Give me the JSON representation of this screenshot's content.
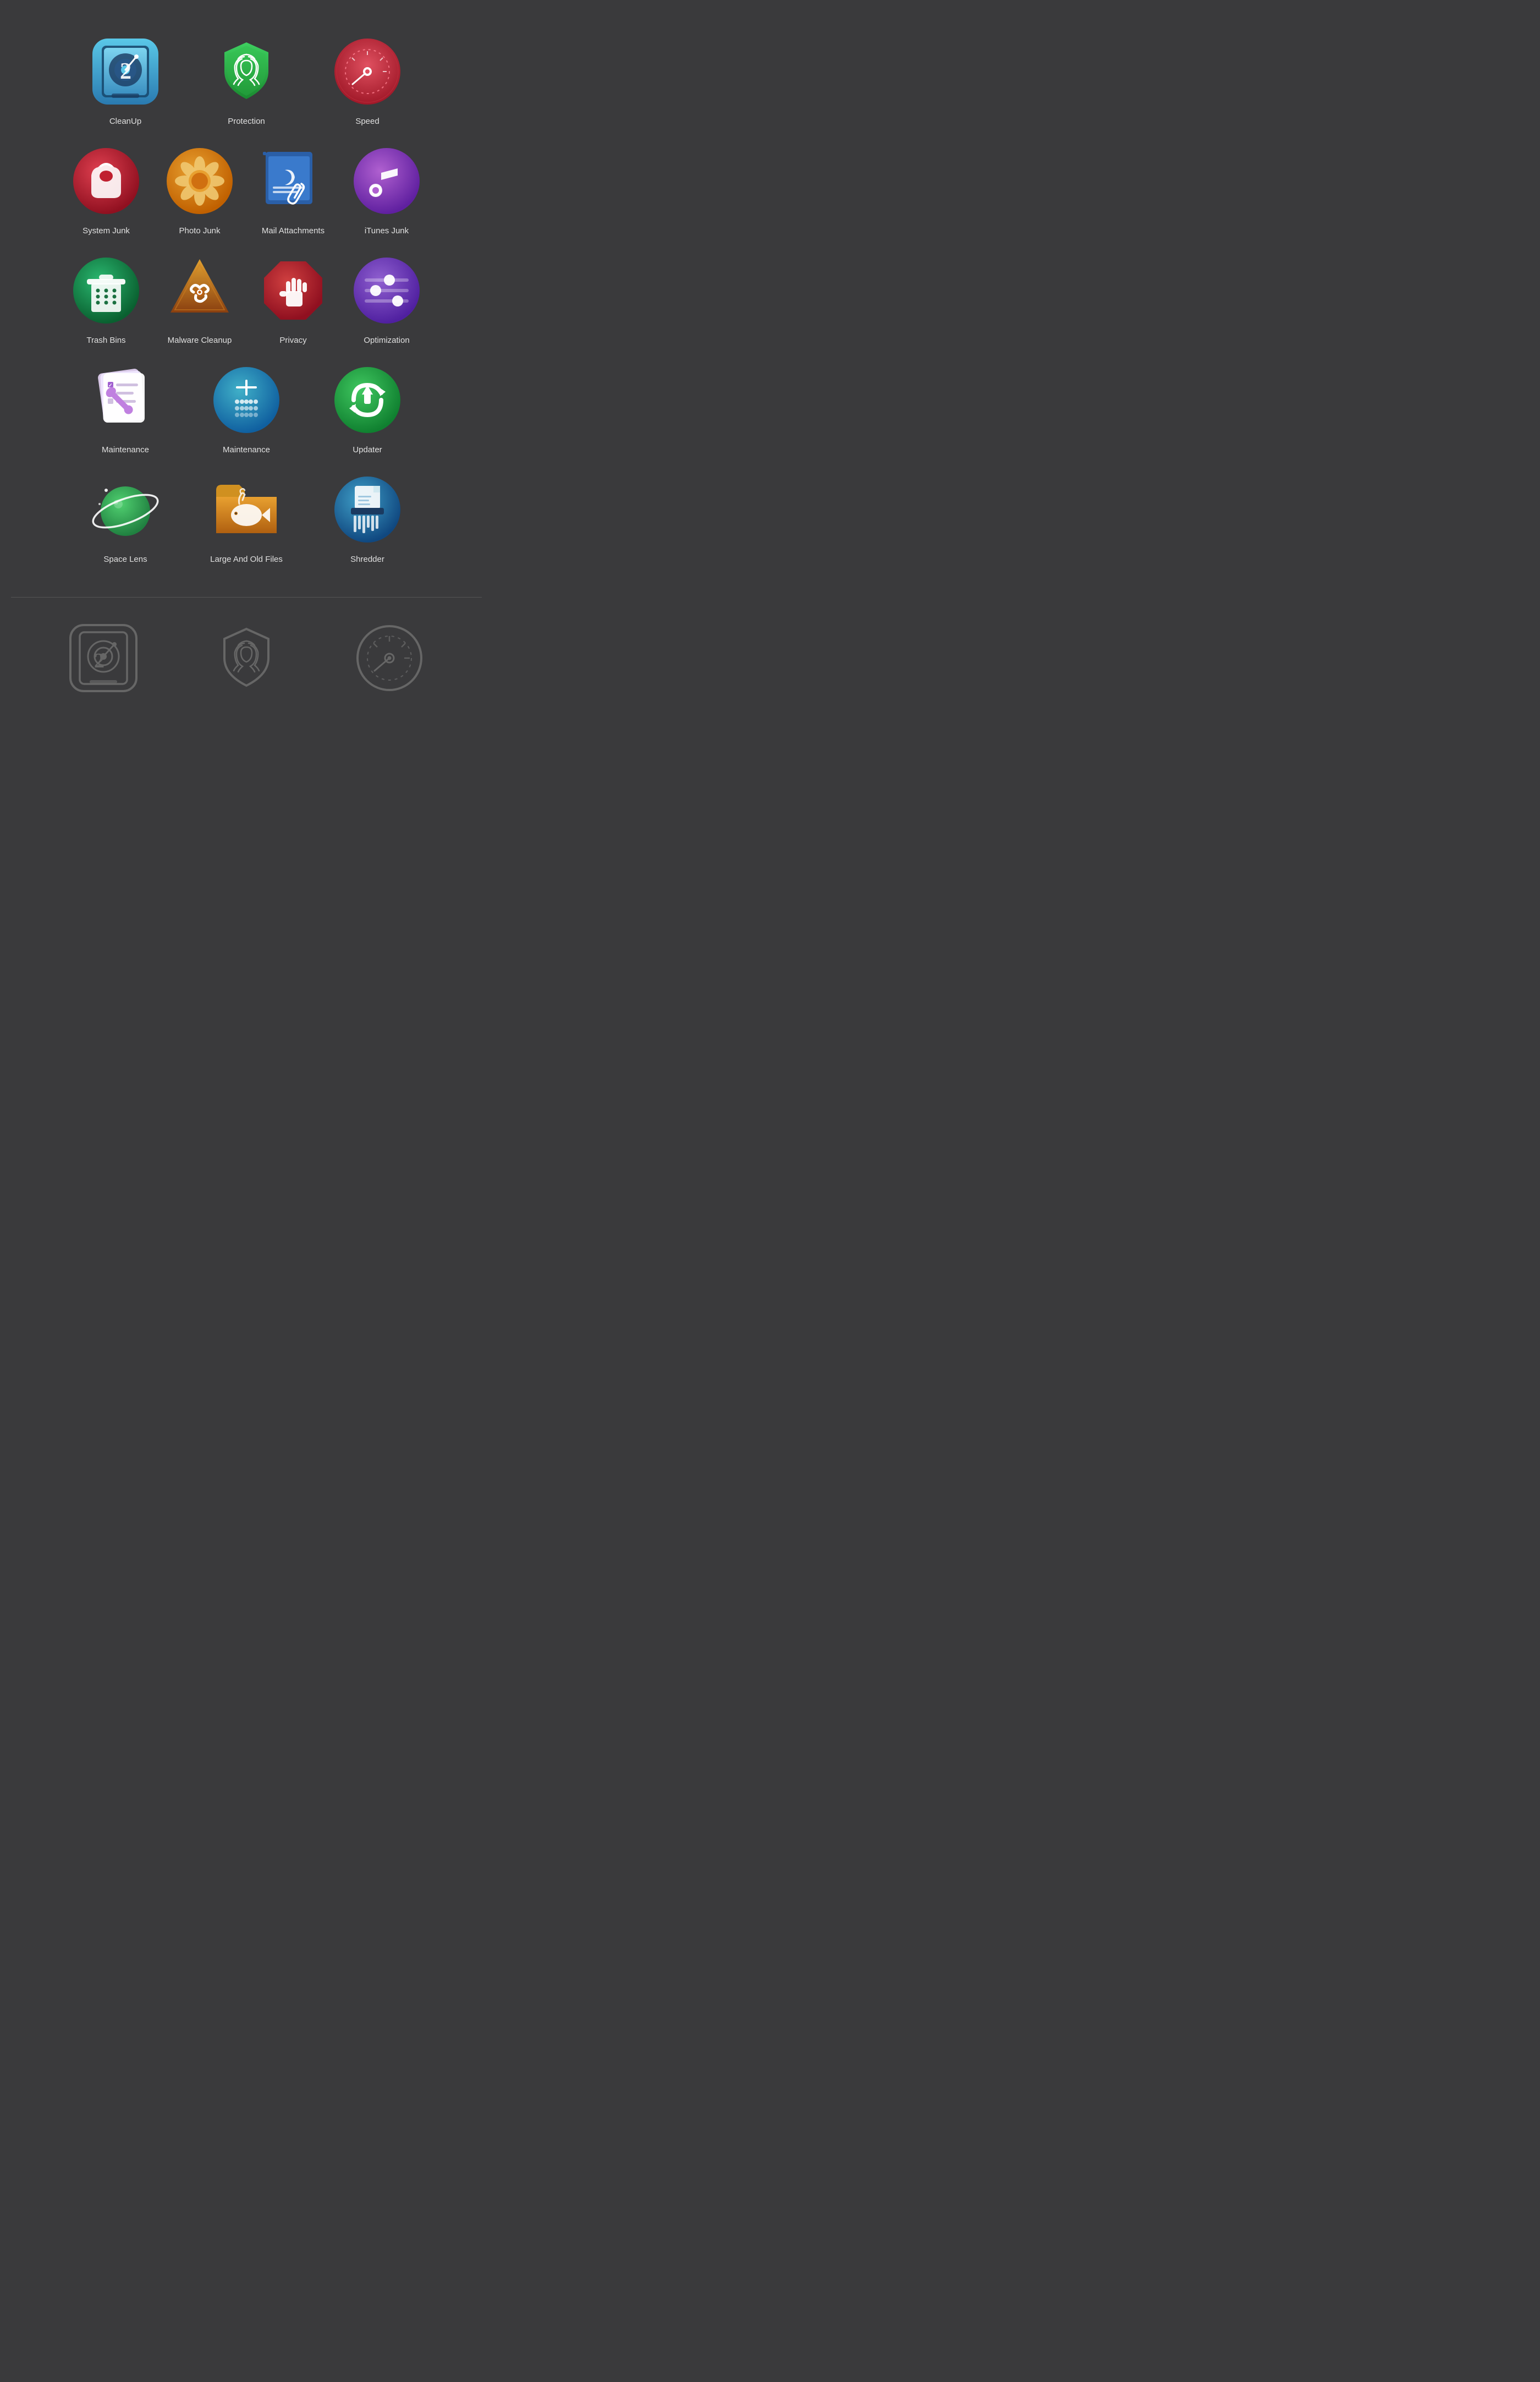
{
  "icons": [
    {
      "id": "cleanup",
      "label": "CleanUp",
      "row": 1,
      "col": 1
    },
    {
      "id": "protection",
      "label": "Protection",
      "row": 1,
      "col": 2
    },
    {
      "id": "speed",
      "label": "Speed",
      "row": 1,
      "col": 3
    },
    {
      "id": "system-junk",
      "label": "System Junk",
      "row": 2,
      "col": 1
    },
    {
      "id": "photo-junk",
      "label": "Photo Junk",
      "row": 2,
      "col": 2
    },
    {
      "id": "mail-attachments",
      "label": "Mail Attachments",
      "row": 2,
      "col": 3
    },
    {
      "id": "itunes-junk",
      "label": "iTunes Junk",
      "row": 2,
      "col": 4
    },
    {
      "id": "trash-bins",
      "label": "Trash Bins",
      "row": 3,
      "col": 1
    },
    {
      "id": "malware-cleanup",
      "label": "Malware Cleanup",
      "row": 3,
      "col": 2
    },
    {
      "id": "privacy",
      "label": "Privacy",
      "row": 3,
      "col": 3
    },
    {
      "id": "optimization",
      "label": "Optimization",
      "row": 3,
      "col": 4
    },
    {
      "id": "maintenance1",
      "label": "Maintenance",
      "row": 4,
      "col": 1
    },
    {
      "id": "maintenance2",
      "label": "Maintenance",
      "row": 4,
      "col": 2
    },
    {
      "id": "updater",
      "label": "Updater",
      "row": 4,
      "col": 3
    },
    {
      "id": "space-lens",
      "label": "Space Lens",
      "row": 5,
      "col": 1
    },
    {
      "id": "large-old-files",
      "label": "Large And Old Files",
      "row": 5,
      "col": 2
    },
    {
      "id": "shredder",
      "label": "Shredder",
      "row": 5,
      "col": 3
    }
  ],
  "bottom_icons": [
    {
      "id": "cleanup-mono",
      "label": ""
    },
    {
      "id": "protection-mono",
      "label": ""
    },
    {
      "id": "speed-mono",
      "label": ""
    }
  ]
}
